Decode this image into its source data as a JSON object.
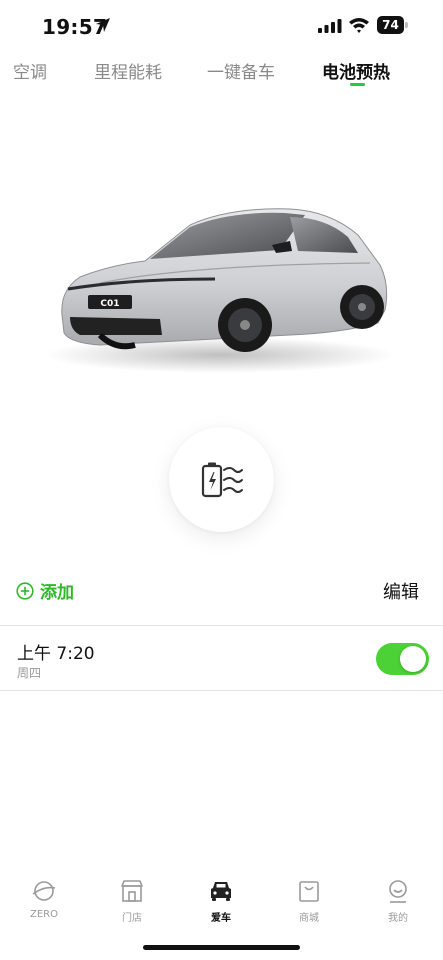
{
  "status_bar": {
    "time": "19:57",
    "battery": "74"
  },
  "tabs": [
    {
      "label": "空调",
      "active": false
    },
    {
      "label": "里程能耗",
      "active": false
    },
    {
      "label": "一键备车",
      "active": false
    },
    {
      "label": "电池预热",
      "active": true
    }
  ],
  "car": {
    "plate_text": "C01"
  },
  "preheat": {
    "icon": "battery-heat-icon"
  },
  "actions": {
    "add_label": "添加",
    "edit_label": "编辑"
  },
  "schedules": [
    {
      "time": "上午 7:20",
      "day": "周四",
      "enabled": true
    }
  ],
  "colors": {
    "accent": "#2fb829",
    "toggle_on": "#4cd137"
  },
  "bottom_nav": [
    {
      "label": "ZERO",
      "icon": "planet-icon",
      "active": false
    },
    {
      "label": "门店",
      "icon": "store-icon",
      "active": false
    },
    {
      "label": "爱车",
      "icon": "car-icon",
      "active": true
    },
    {
      "label": "商城",
      "icon": "shopping-bag-icon",
      "active": false
    },
    {
      "label": "我的",
      "icon": "profile-icon",
      "active": false
    }
  ]
}
